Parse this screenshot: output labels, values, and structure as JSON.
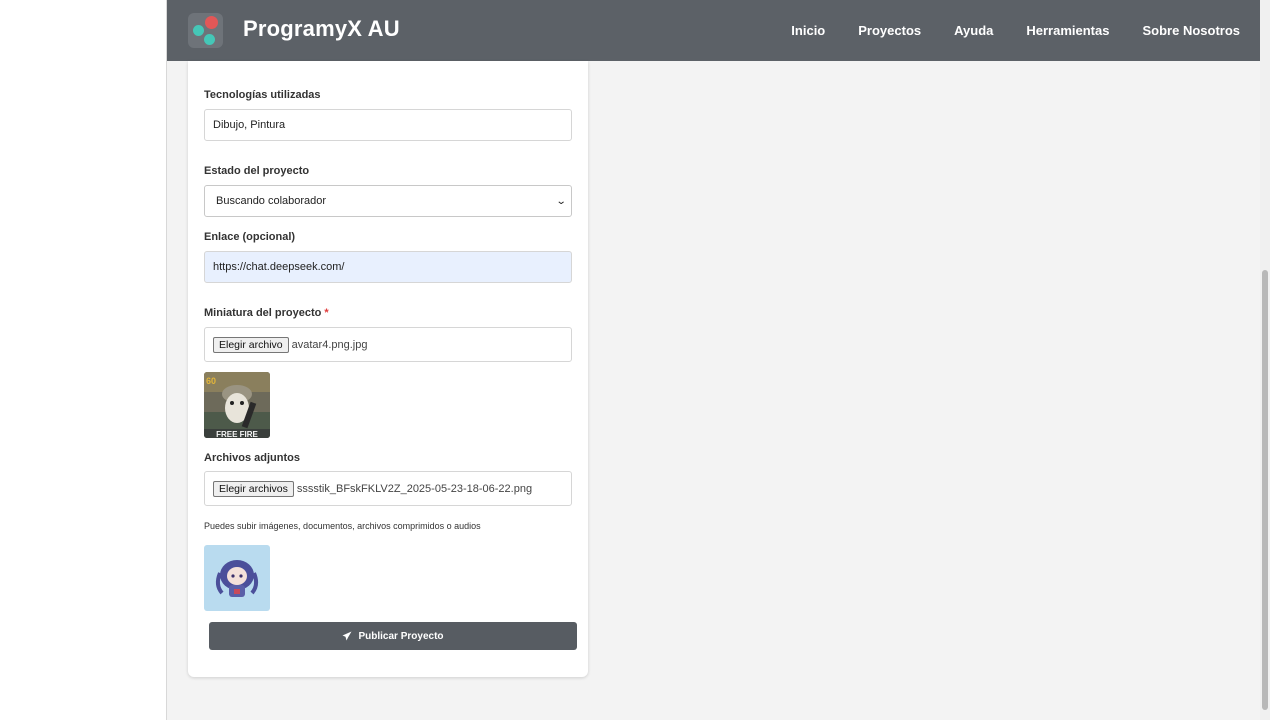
{
  "brand": {
    "name": "ProgramyX AU"
  },
  "nav": {
    "items": [
      "Inicio",
      "Proyectos",
      "Ayuda",
      "Herramientas",
      "Sobre Nosotros"
    ]
  },
  "form": {
    "tech_label": "Tecnologías utilizadas",
    "tech_value": "Dibujo, Pintura",
    "status_label": "Estado del proyecto",
    "status_value": "Buscando colaborador",
    "link_label": "Enlace (opcional)",
    "link_value": "https://chat.deepseek.com/",
    "thumbnail_label": "Miniatura del proyecto",
    "required_mark": "*",
    "thumbnail_button": "Elegir archivo",
    "thumbnail_file": "avatar4.png.jpg",
    "attachments_label": "Archivos adjuntos",
    "attachments_button": "Elegir archivos",
    "attachments_file": "sssstik_BFskFKLV2Z_2025-05-23-18-06-22.png",
    "attachments_help": "Puedes subir imágenes, documentos, archivos comprimidos o audios",
    "publish_label": "Publicar Proyecto"
  },
  "thumbnail_image": {
    "caption": "FREE FIRE"
  },
  "colors": {
    "navbar": "#5c6167",
    "accent_red": "#e25757",
    "accent_teal": "#45c7b7",
    "button": "#575c62",
    "autofill": "#e8f0fe"
  },
  "icons": {
    "publish": "paper-plane-icon",
    "select": "chevron-down-icon"
  }
}
